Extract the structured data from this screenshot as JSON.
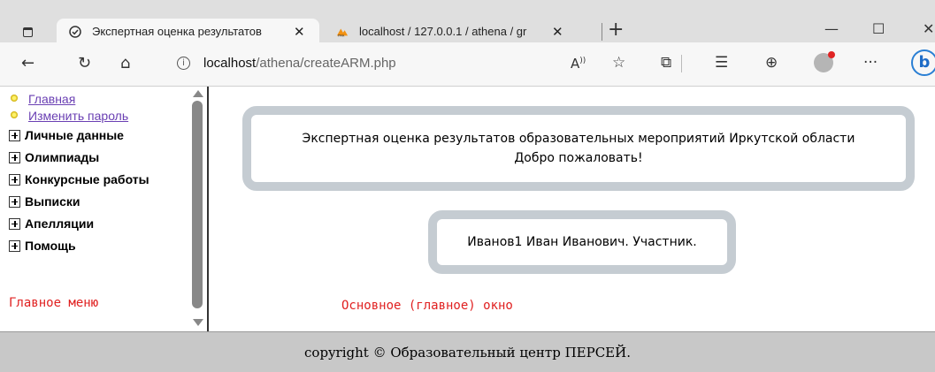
{
  "browser": {
    "tabs": [
      {
        "title": "Экспертная оценка результатов",
        "active": true,
        "favicon": "check-circle-icon"
      },
      {
        "title": "localhost / 127.0.0.1 / athena / gr",
        "active": false,
        "favicon": "phpmyadmin-icon"
      }
    ],
    "url_host": "localhost",
    "url_path": "/athena/createARM.php"
  },
  "sidebar": {
    "links": [
      {
        "label": "Главная"
      },
      {
        "label": "Изменить пароль"
      }
    ],
    "tree": [
      {
        "label": "Личные данные"
      },
      {
        "label": "Олимпиады"
      },
      {
        "label": "Конкурсные работы"
      },
      {
        "label": "Выписки"
      },
      {
        "label": "Апелляции"
      },
      {
        "label": "Помощь"
      }
    ],
    "note": "Главное меню"
  },
  "main": {
    "header_line1": "Экспертная оценка результатов образовательных мероприятий Иркутской области",
    "header_line2": "Добро пожаловать!",
    "user_info": "Иванов1 Иван Иванович. Участник.",
    "note": "Основное (главное) окно"
  },
  "footer": {
    "text": "copyright © Образовательный центр ПЕРСЕЙ."
  }
}
